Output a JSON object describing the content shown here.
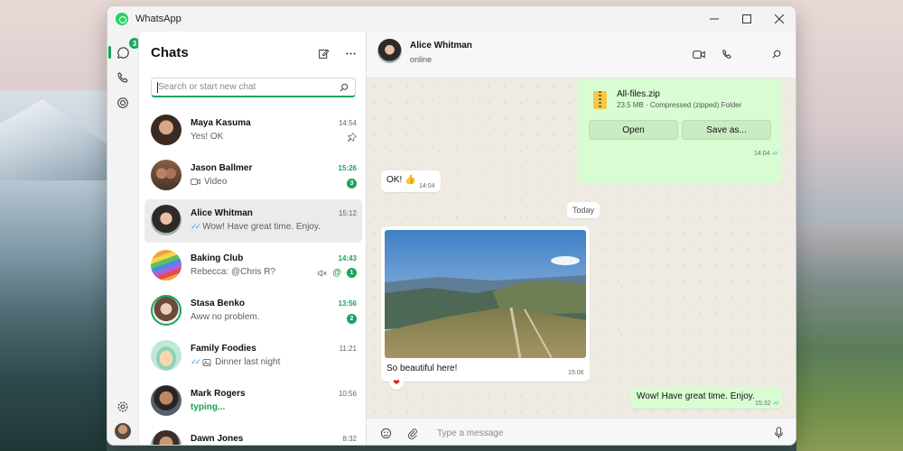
{
  "window": {
    "title": "WhatsApp",
    "controls": {
      "minimize": "—",
      "maximize": "☐",
      "close": "✕"
    }
  },
  "rail": {
    "chats_badge": "3",
    "items": [
      {
        "icon": "chat-icon",
        "active": true
      },
      {
        "icon": "phone-icon"
      },
      {
        "icon": "status-icon"
      }
    ],
    "bottom": [
      {
        "icon": "gear-icon"
      },
      {
        "icon": "profile-avatar"
      }
    ]
  },
  "chat_list": {
    "title": "Chats",
    "search_placeholder": "Search or start new chat",
    "chats": [
      {
        "name": "Maya Kasuma",
        "preview": "Yes! OK",
        "time": "14:54",
        "unread": "",
        "pinned": true
      },
      {
        "name": "Jason Ballmer",
        "preview": "Video",
        "time": "15:26",
        "unread": "3",
        "preview_icon": "video-icon"
      },
      {
        "name": "Alice Whitman",
        "preview": "Wow! Have great time. Enjoy.",
        "time": "15:12",
        "unread": "",
        "selected": true,
        "ticks": "read"
      },
      {
        "name": "Baking Club",
        "preview": "Rebecca: @Chris R?",
        "time": "14:43",
        "unread": "1",
        "muted": true,
        "mention": "@"
      },
      {
        "name": "Stasa Benko",
        "preview": "Aww no problem.",
        "time": "13:56",
        "unread": "2"
      },
      {
        "name": "Family Foodies",
        "preview": "Dinner last night",
        "time": "11:21",
        "unread": "",
        "ticks": "read",
        "preview_icon": "image-icon"
      },
      {
        "name": "Mark Rogers",
        "preview": "typing...",
        "time": "10:56",
        "unread": "",
        "typing": true
      },
      {
        "name": "Dawn Jones",
        "preview": "",
        "time": "8:32",
        "unread": ""
      }
    ]
  },
  "conversation": {
    "contact_name": "Alice Whitman",
    "contact_status": "online",
    "header_icons": [
      "video-call-icon",
      "voice-call-icon",
      "search-icon"
    ],
    "file_message": {
      "file_name": "All-files.zip",
      "file_meta": "23.5 MB · Compressed (zipped) Folder",
      "open_label": "Open",
      "save_label": "Save as...",
      "time": "14:04"
    },
    "ok_message": {
      "text": "OK! 👍",
      "time": "14:04"
    },
    "date_divider": "Today",
    "photo_message": {
      "caption": "So beautiful here!",
      "time": "15:06",
      "reaction": "❤"
    },
    "last_message": {
      "text": "Wow! Have great time. Enjoy.",
      "time": "15:32"
    },
    "composer_placeholder": "Type a message"
  },
  "colors": {
    "accent": "#1aa45b",
    "outgoing_bubble": "#d9fdd3",
    "incoming_bubble": "#ffffff",
    "read_ticks": "#4a9fe0"
  }
}
